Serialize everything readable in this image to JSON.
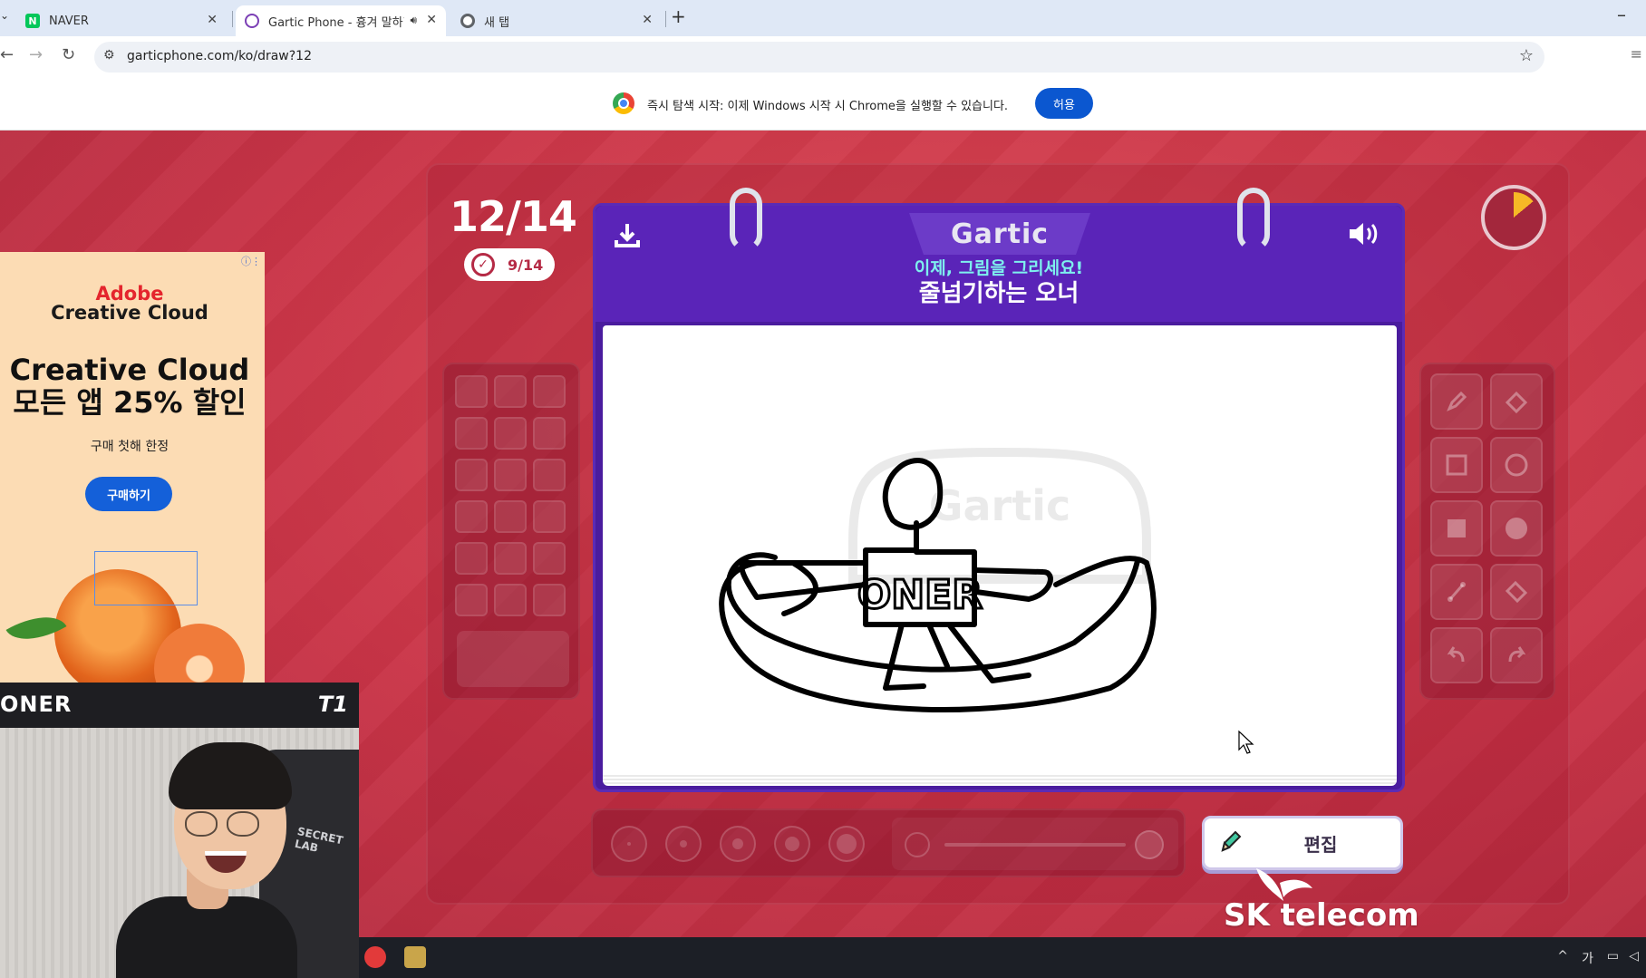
{
  "browser": {
    "tabs": [
      {
        "title": "NAVER",
        "favicon_color": "#03c75a",
        "favicon_letter": "N"
      },
      {
        "title": "Gartic Phone - 흉겨 말하7",
        "favicon_color": "#7b3fb5",
        "active": true
      },
      {
        "title": "새 탭",
        "favicon_color": "#5f6368"
      }
    ],
    "new_tab": "+",
    "url": "garticphone.com/ko/draw?12",
    "infobar_text": "즉시 탐색 시작: 이제 Windows 시작 시 Chrome을 실행할 수 있습니다.",
    "infobar_button": "허용"
  },
  "game": {
    "round": "12/14",
    "done_count": "9/14",
    "timer_progress": 0.14,
    "logo": "Gartic",
    "instruction": "이제, 그림을 그리세요!",
    "prompt": "줄넘기하는 오너",
    "edit_button": "편집",
    "colors": {
      "accent": "#4a1c9e",
      "header": "#5a24b8",
      "instruction_color": "#7ef0ee",
      "timer_fill": "#f6b926"
    },
    "canvas_text": "ONER",
    "tools": [
      "pencil-tool",
      "eraser-tool",
      "rectangle-outline-tool",
      "circle-outline-tool",
      "rectangle-fill-tool",
      "circle-fill-tool",
      "line-tool",
      "fill-bucket-tool",
      "undo-tool",
      "redo-tool"
    ]
  },
  "ad": {
    "brand1": "Adobe",
    "brand2": "Creative Cloud",
    "head1": "Creative Cloud",
    "head2": "모든 앱 25% 할인",
    "sub": "구매 첫해 한정",
    "button": "구매하기"
  },
  "webcam": {
    "name": "ONER",
    "team_logo": "T1",
    "chair_text": "SECRET LAB"
  },
  "sponsor": {
    "text": "SK telecom"
  },
  "taskbar": {
    "tray": [
      "^",
      "가"
    ]
  }
}
